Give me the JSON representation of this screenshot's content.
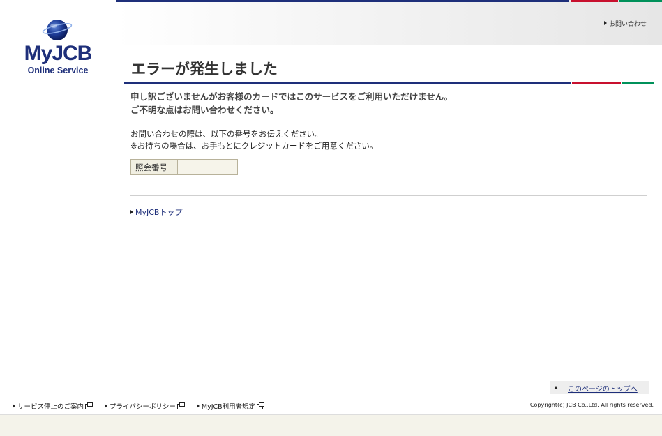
{
  "logo": {
    "brand": "MyJCB",
    "subtitle": "Online Service"
  },
  "header": {
    "contact_link": "お問い合わせ"
  },
  "main": {
    "title": "エラーが発生しました",
    "message_lines": [
      "申し訳ございませんがお客様のカードではこのサービスをご利用いただけません。",
      "ご不明な点はお問い合わせください。"
    ],
    "info_lines": [
      "お問い合わせの際は、以下の番号をお伝えください。",
      "※お持ちの場合は、お手もとにクレジットカードをご用意ください。"
    ],
    "reference": {
      "label": "照会番号",
      "value": ""
    },
    "home_link": "MyJCBトップ"
  },
  "page_top": {
    "label": "このページのトップへ"
  },
  "footer": {
    "links": [
      "サービス停止のご案内",
      "プライバシーポリシー",
      "MyJCB利用者規定"
    ],
    "copyright": "Copyright(c) JCB Co.,Ltd. All rights reserved."
  },
  "colors": {
    "brand_blue": "#1e2f7a",
    "accent_red": "#c8102e",
    "accent_green": "#00915a"
  }
}
